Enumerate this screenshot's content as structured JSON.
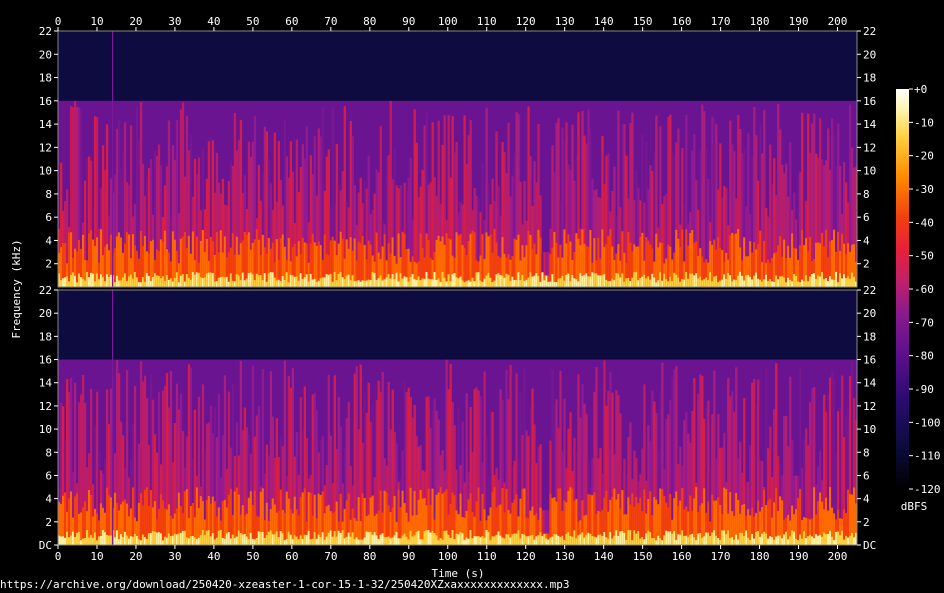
{
  "chart_data": {
    "type": "heatmap",
    "xlabel": "Time (s)",
    "ylabel": "Frequency (kHz)",
    "xlim": [
      0,
      205
    ],
    "ylim": [
      0,
      22
    ],
    "x_ticks": [
      0,
      10,
      20,
      30,
      40,
      50,
      60,
      70,
      80,
      90,
      100,
      110,
      120,
      130,
      140,
      150,
      160,
      170,
      180,
      190,
      200
    ],
    "y_ticks_top": [
      {
        "v": 2,
        "label": "2"
      },
      {
        "v": 4,
        "label": "4"
      },
      {
        "v": 6,
        "label": "6"
      },
      {
        "v": 8,
        "label": "8"
      },
      {
        "v": 10,
        "label": "10"
      },
      {
        "v": 12,
        "label": "12"
      },
      {
        "v": 14,
        "label": "14"
      },
      {
        "v": 16,
        "label": "16"
      },
      {
        "v": 18,
        "label": "18"
      },
      {
        "v": 20,
        "label": "20"
      },
      {
        "v": 22,
        "label": "22"
      }
    ],
    "y_ticks_bottom": [
      {
        "v": 0,
        "label": "DC"
      },
      {
        "v": 2,
        "label": "2"
      },
      {
        "v": 4,
        "label": "4"
      },
      {
        "v": 6,
        "label": "6"
      },
      {
        "v": 8,
        "label": "8"
      },
      {
        "v": 10,
        "label": "10"
      },
      {
        "v": 12,
        "label": "12"
      },
      {
        "v": 14,
        "label": "14"
      },
      {
        "v": 16,
        "label": "16"
      },
      {
        "v": 18,
        "label": "18"
      },
      {
        "v": 20,
        "label": "20"
      },
      {
        "v": 22,
        "label": "22"
      }
    ],
    "channels": 2,
    "lowpass_cutoff_khz": 16,
    "colorbar": {
      "unit": "dBFS",
      "ticks": [
        {
          "v": 0,
          "label": "+0"
        },
        {
          "v": -10,
          "label": "-10"
        },
        {
          "v": -20,
          "label": "-20"
        },
        {
          "v": -30,
          "label": "-30"
        },
        {
          "v": -40,
          "label": "-40"
        },
        {
          "v": -50,
          "label": "-50"
        },
        {
          "v": -60,
          "label": "-60"
        },
        {
          "v": -70,
          "label": "-70"
        },
        {
          "v": -80,
          "label": "-80"
        },
        {
          "v": -90,
          "label": "-90"
        },
        {
          "v": -100,
          "label": "-100"
        },
        {
          "v": -110,
          "label": "-110"
        },
        {
          "v": -120,
          "label": "-120"
        }
      ],
      "range": [
        -120,
        0
      ],
      "colors": [
        "#000000",
        "#0b0b3a",
        "#2a0b6e",
        "#5a0f8a",
        "#8a1a8f",
        "#c0206a",
        "#e8203a",
        "#f2400f",
        "#ff8a00",
        "#ffd040",
        "#fff5b0",
        "#ffffff"
      ]
    }
  },
  "source": {
    "url": "https://archive.org/download/250420-xzeaster-1-cor-15-1-32/250420XZxaxxxxxxxxxxxxx.mp3"
  }
}
